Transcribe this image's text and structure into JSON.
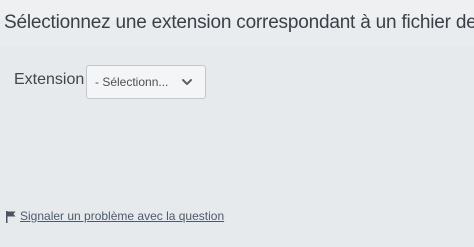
{
  "question": {
    "text": "Sélectionnez une extension correspondant à un fichier de présentatio"
  },
  "extension_field": {
    "label": "Extension :",
    "selected_value": "- Sélectionn...",
    "icon": "chevron-down-icon"
  },
  "report": {
    "icon": "flag-icon",
    "link_text": "Signaler un problème avec la question"
  },
  "colors": {
    "background": "#e9ecee",
    "text": "#3b4249",
    "link": "#4c5a6a"
  }
}
